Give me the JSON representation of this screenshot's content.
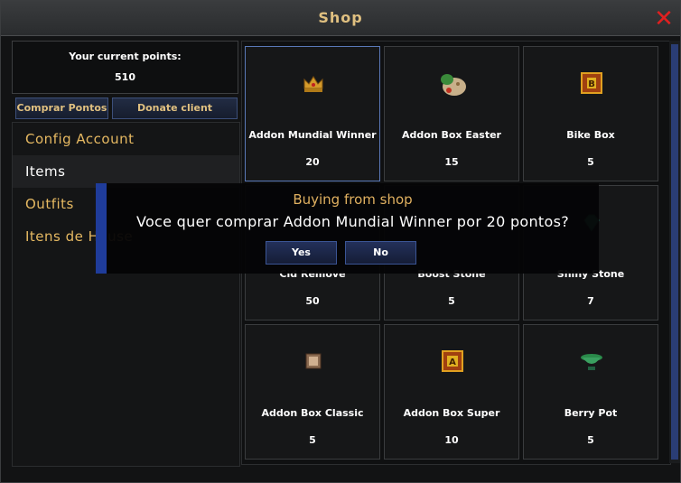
{
  "window": {
    "title": "Shop"
  },
  "points": {
    "label": "Your current points:",
    "value": "510"
  },
  "buttons": {
    "buy_points": "Comprar Pontos",
    "donate_client": "Donate client"
  },
  "menu": {
    "items": [
      {
        "label": "Config Account"
      },
      {
        "label": "Items"
      },
      {
        "label": "Outfits"
      },
      {
        "label": "Itens de House"
      }
    ]
  },
  "products": [
    {
      "name": "Addon Mundial Winner",
      "price": "20",
      "icon": "crown-icon"
    },
    {
      "name": "Addon Box Easter",
      "price": "15",
      "icon": "easter-box-icon"
    },
    {
      "name": "Bike Box",
      "price": "5",
      "icon": "bike-box-icon"
    },
    {
      "name": "Cid Remove",
      "price": "50",
      "icon": "cid-icon"
    },
    {
      "name": "Boost Stone",
      "price": "5",
      "icon": "boost-stone-icon"
    },
    {
      "name": "Shiny Stone",
      "price": "7",
      "icon": "shiny-stone-icon"
    },
    {
      "name": "Addon Box Classic",
      "price": "5",
      "icon": "classic-box-icon"
    },
    {
      "name": "Addon Box Super",
      "price": "10",
      "icon": "super-box-icon"
    },
    {
      "name": "Berry Pot",
      "price": "5",
      "icon": "berry-pot-icon"
    }
  ],
  "dialog": {
    "title": "Buying from shop",
    "message": "Voce quer comprar Addon Mundial Winner por 20 pontos?",
    "yes": "Yes",
    "no": "No"
  },
  "colors": {
    "accent_gold": "#e6b962",
    "close_red": "#e02020",
    "dialog_blue": "#1f3c9a"
  }
}
